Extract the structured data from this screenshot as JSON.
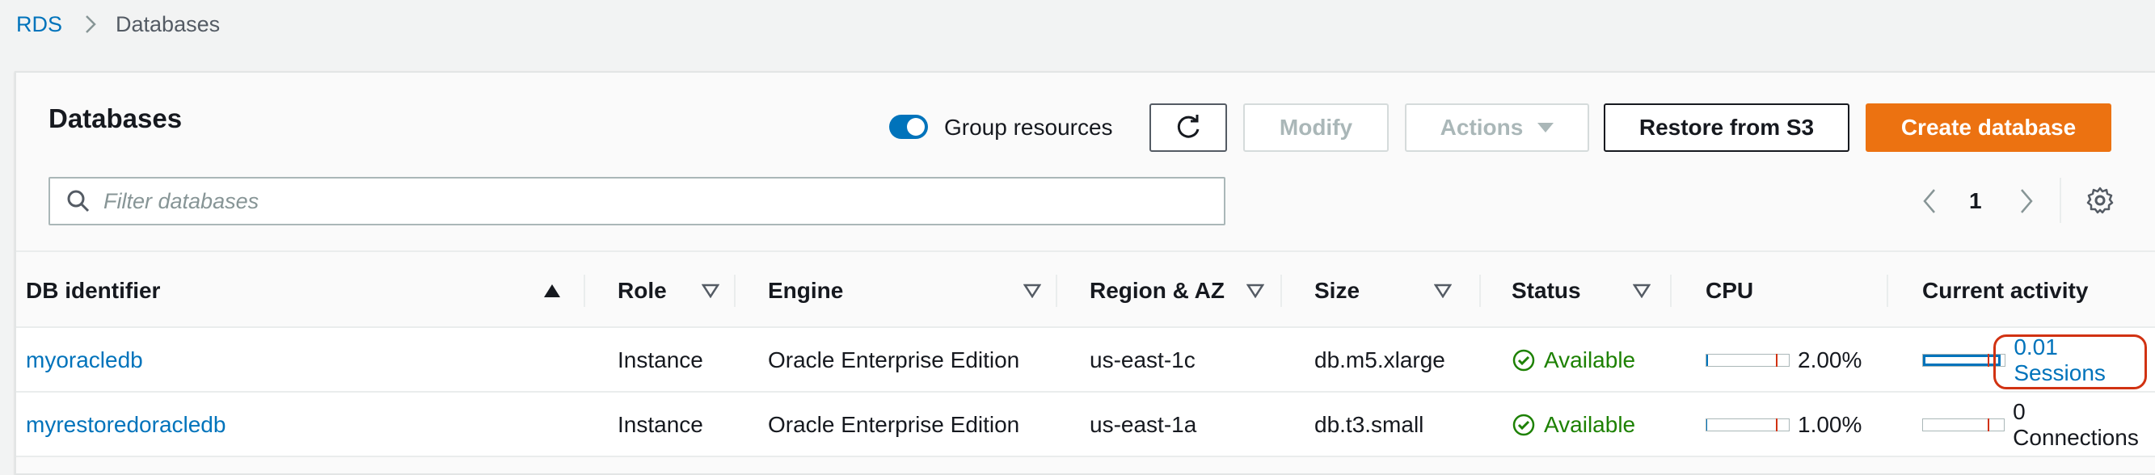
{
  "breadcrumb": {
    "root": "RDS",
    "current": "Databases"
  },
  "header": {
    "title": "Databases",
    "group_toggle_label": "Group resources",
    "group_toggle_on": true,
    "buttons": {
      "modify": "Modify",
      "actions": "Actions",
      "restore": "Restore from S3",
      "create": "Create database"
    }
  },
  "search": {
    "placeholder": "Filter databases",
    "value": ""
  },
  "pagination": {
    "page": "1"
  },
  "columns": [
    "DB identifier",
    "Role",
    "Engine",
    "Region & AZ",
    "Size",
    "Status",
    "CPU",
    "Current activity"
  ],
  "rows": [
    {
      "id": "myoracledb",
      "role": "Instance",
      "engine": "Oracle Enterprise Edition",
      "region": "us-east-1c",
      "size": "db.m5.xlarge",
      "status": "Available",
      "cpu_text": "2.00%",
      "cpu_fraction": 0.02,
      "activity_text": "0.01 Sessions",
      "activity_fraction": 0.95,
      "activity_is_link": true
    },
    {
      "id": "myrestoredoracledb",
      "role": "Instance",
      "engine": "Oracle Enterprise Edition",
      "region": "us-east-1a",
      "size": "db.t3.small",
      "status": "Available",
      "cpu_text": "1.00%",
      "cpu_fraction": 0.01,
      "activity_text": "0 Connections",
      "activity_fraction": 0.0,
      "activity_is_link": false
    }
  ],
  "colors": {
    "link": "#0073bb",
    "primary": "#ec7211",
    "success": "#1d8102",
    "highlight": "#d13212"
  }
}
